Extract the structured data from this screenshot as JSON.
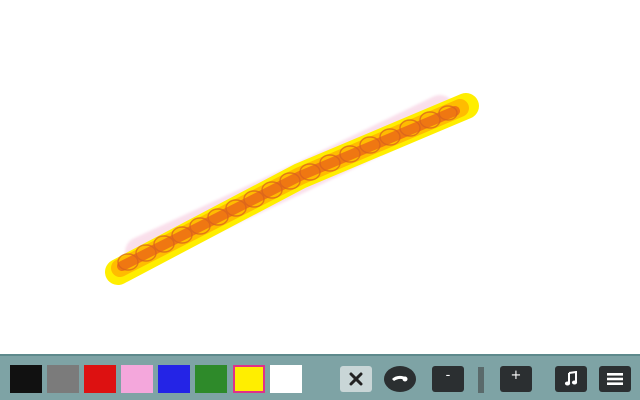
{
  "app": {
    "name": "drawing-canvas"
  },
  "stroke": {
    "outer_color": "#ffee00",
    "mid_color": "#ffb300",
    "inner_color": "#e85a1a",
    "shadow_color": "#f0a6c8"
  },
  "palette": [
    {
      "name": "black",
      "color": "#111111",
      "selected": false
    },
    {
      "name": "gray",
      "color": "#7b7b7b",
      "selected": false
    },
    {
      "name": "red",
      "color": "#dd1111",
      "selected": false
    },
    {
      "name": "pink",
      "color": "#f4a7dc",
      "selected": false
    },
    {
      "name": "blue",
      "color": "#2424e6",
      "selected": false
    },
    {
      "name": "green",
      "color": "#2e8a2a",
      "selected": false
    },
    {
      "name": "yellow",
      "color": "#ffee00",
      "selected": true
    },
    {
      "name": "white",
      "color": "#ffffff",
      "selected": false
    }
  ],
  "toolbar": {
    "clear_icon": "close-icon",
    "brush_icon": "brush-icon",
    "minus_label": "-",
    "plus_label": "+",
    "music_icon": "music-note-icon",
    "menu_icon": "menu-icon"
  }
}
